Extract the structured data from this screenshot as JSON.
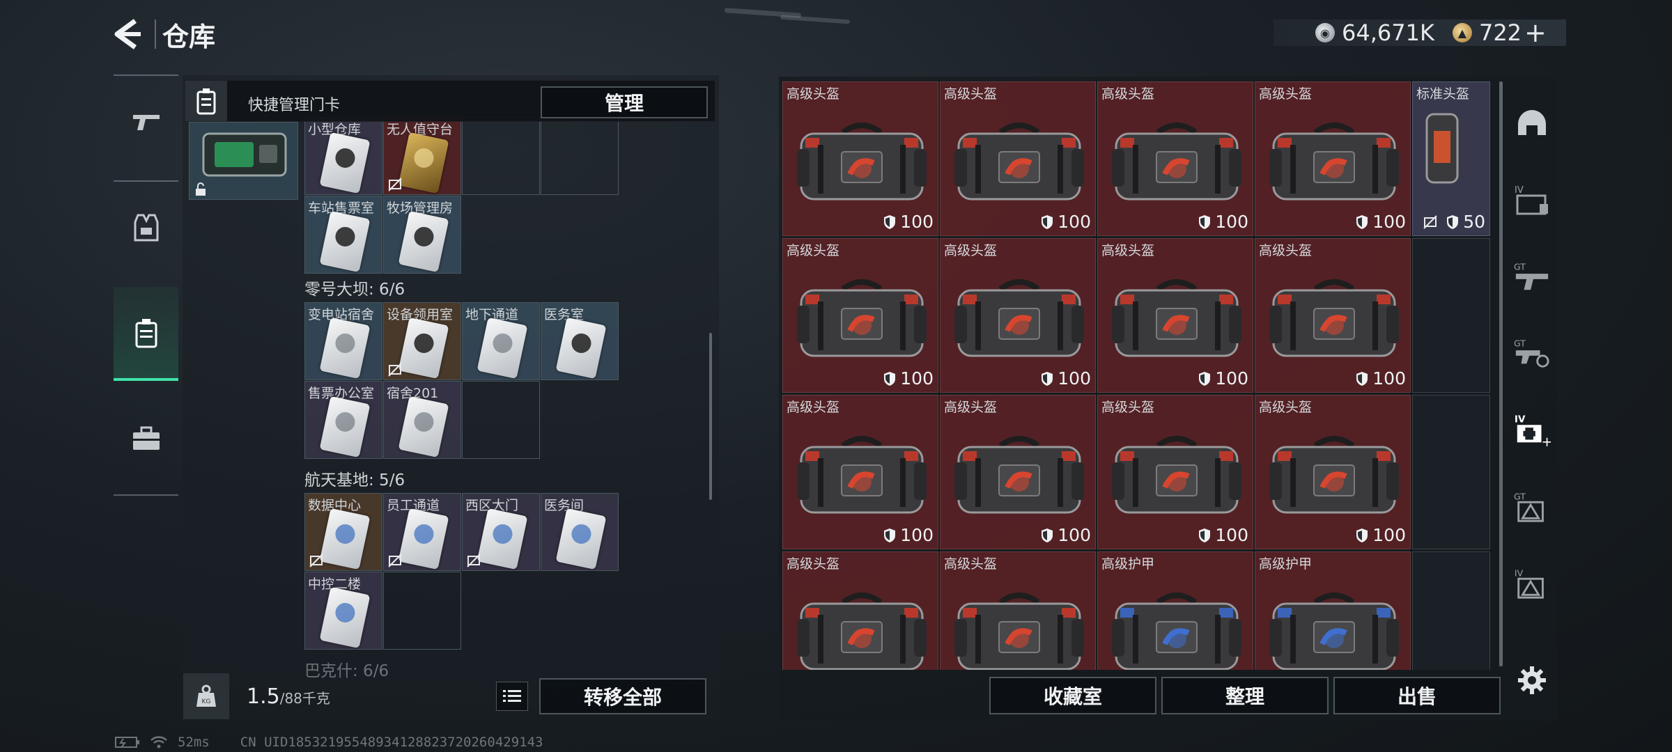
{
  "header": {
    "title": "仓库",
    "silver_amount": "64,671K",
    "gold_amount": "722",
    "plus_label": "+"
  },
  "left_panel": {
    "quick_label": "快捷管理门卡",
    "manage_label": "管理",
    "top_slots": [
      {
        "label": "小型仓库",
        "card": "dark",
        "bg": "purple"
      },
      {
        "label": "无人值守台",
        "card": "gold",
        "bg": "red",
        "nodrop": true
      },
      {
        "label": "车站售票室",
        "card": "dark",
        "bg": "blue"
      },
      {
        "label": "牧场管理房",
        "card": "dark",
        "bg": "blue"
      }
    ],
    "sections": [
      {
        "title": "零号大坝: 6/6",
        "slots": [
          {
            "label": "变电站宿舍",
            "card": "grey",
            "bg": "blue"
          },
          {
            "label": "设备领用室",
            "card": "dark",
            "bg": "brown",
            "nodrop": true
          },
          {
            "label": "地下通道",
            "card": "grey",
            "bg": "blue"
          },
          {
            "label": "医务室",
            "card": "dark",
            "bg": "blue"
          },
          {
            "label": "售票办公室",
            "card": "grey",
            "bg": "purple"
          },
          {
            "label": "宿舍201",
            "card": "grey",
            "bg": "purple"
          }
        ]
      },
      {
        "title": "航天基地: 5/6",
        "slots": [
          {
            "label": "数据中心",
            "card": "blue",
            "bg": "brown",
            "nodrop": true
          },
          {
            "label": "员工通道",
            "card": "blue",
            "bg": "purple",
            "nodrop": true
          },
          {
            "label": "西区大门",
            "card": "blue",
            "bg": "purple",
            "nodrop": true
          },
          {
            "label": "医务间",
            "card": "blue",
            "bg": "purple"
          },
          {
            "label": "中控二楼",
            "card": "blue",
            "bg": "purple"
          }
        ]
      },
      {
        "title": "巴克什: 6/6",
        "slots": []
      }
    ],
    "weight_value": "1.5",
    "weight_capacity": "/88千克",
    "transfer_label": "转移全部"
  },
  "grid": {
    "items": [
      {
        "label": "高级头盔",
        "durability": "100",
        "kind": "helmet"
      },
      {
        "label": "高级头盔",
        "durability": "100",
        "kind": "helmet"
      },
      {
        "label": "高级头盔",
        "durability": "100",
        "kind": "helmet"
      },
      {
        "label": "高级头盔",
        "durability": "100",
        "kind": "helmet"
      },
      {
        "label": "标准头盔",
        "durability": "50",
        "kind": "standard",
        "nodrop": true
      },
      {
        "label": "高级头盔",
        "durability": "100",
        "kind": "helmet"
      },
      {
        "label": "高级头盔",
        "durability": "100",
        "kind": "helmet"
      },
      {
        "label": "高级头盔",
        "durability": "100",
        "kind": "helmet"
      },
      {
        "label": "高级头盔",
        "durability": "100",
        "kind": "helmet"
      },
      {
        "label": "",
        "durability": "",
        "kind": "empty"
      },
      {
        "label": "高级头盔",
        "durability": "100",
        "kind": "helmet"
      },
      {
        "label": "高级头盔",
        "durability": "100",
        "kind": "helmet"
      },
      {
        "label": "高级头盔",
        "durability": "100",
        "kind": "helmet"
      },
      {
        "label": "高级头盔",
        "durability": "100",
        "kind": "helmet"
      },
      {
        "label": "",
        "durability": "",
        "kind": "empty"
      },
      {
        "label": "高级头盔",
        "durability": "",
        "kind": "helmet"
      },
      {
        "label": "高级头盔",
        "durability": "",
        "kind": "helmet"
      },
      {
        "label": "高级护甲",
        "durability": "",
        "kind": "armor"
      },
      {
        "label": "高级护甲",
        "durability": "",
        "kind": "armor"
      },
      {
        "label": "",
        "durability": "",
        "kind": "empty"
      }
    ],
    "collection_label": "收藏室",
    "sort_label": "整理",
    "sell_label": "出售"
  },
  "side_icons": [
    "helmet-slot-icon",
    "iv-folder-icon",
    "gt-gun-icon",
    "gt-settings-icon",
    "iv-medkit-icon",
    "gt-warning-icon",
    "iv-warning-icon",
    "settings-gear-icon"
  ],
  "status": {
    "ping": "52ms",
    "uid": "CN UID18532195548934128823720260429143"
  },
  "colors": {
    "accent": "#3fe3a8",
    "item_red": "#5c2226",
    "item_purple": "#3c3c52"
  }
}
